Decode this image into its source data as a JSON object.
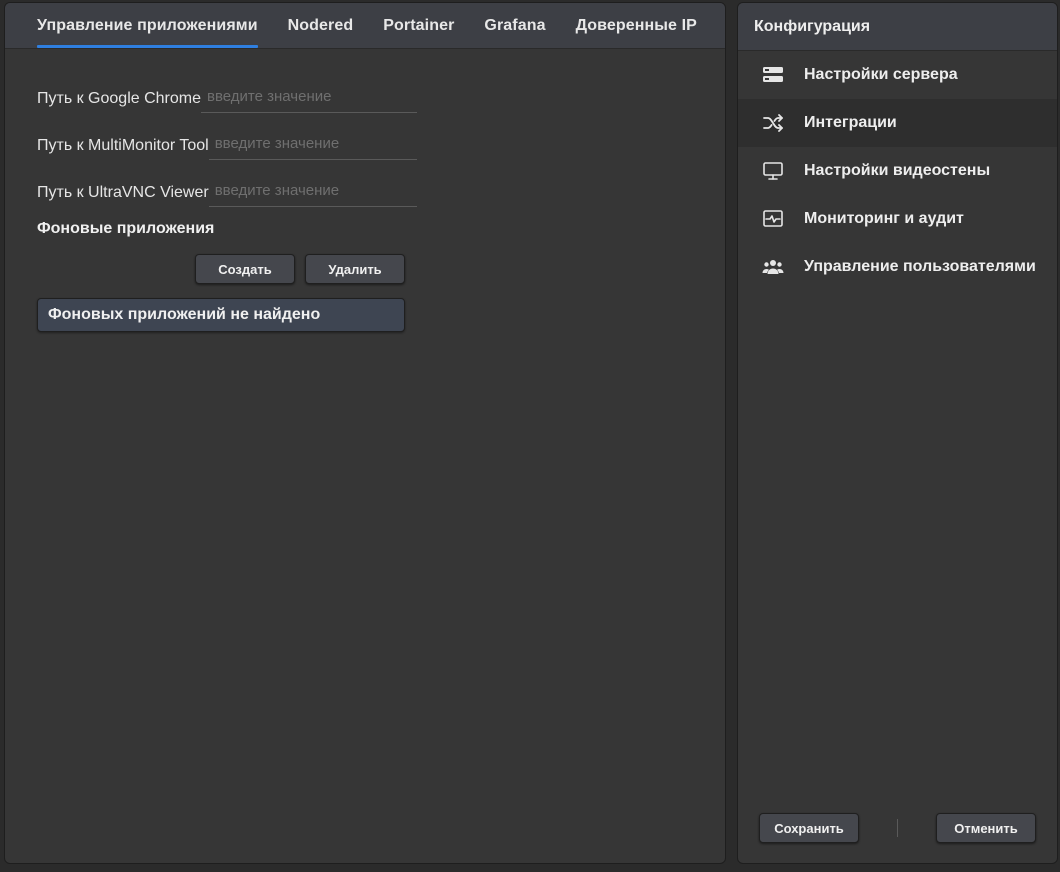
{
  "tabs": [
    {
      "label": "Управление приложениями",
      "active": true
    },
    {
      "label": "Nodered",
      "active": false
    },
    {
      "label": "Portainer",
      "active": false
    },
    {
      "label": "Grafana",
      "active": false
    },
    {
      "label": "Доверенные IP",
      "active": false
    }
  ],
  "form": {
    "fields": [
      {
        "label": "Путь к Google Chrome",
        "value": "",
        "placeholder": "введите значение"
      },
      {
        "label": "Путь к MultiMonitor Tool",
        "value": "",
        "placeholder": "введите значение"
      },
      {
        "label": "Путь к UltraVNC Viewer",
        "value": "",
        "placeholder": "введите значение"
      }
    ],
    "background_apps_title": "Фоновые приложения",
    "create_label": "Создать",
    "delete_label": "Удалить",
    "empty_message": "Фоновых приложений не найдено"
  },
  "sidebar": {
    "title": "Конфигурация",
    "items": [
      {
        "label": "Настройки сервера",
        "icon": "server-icon",
        "active": false
      },
      {
        "label": "Интеграции",
        "icon": "shuffle-icon",
        "active": true
      },
      {
        "label": "Настройки видеостены",
        "icon": "monitor-icon",
        "active": false
      },
      {
        "label": "Мониторинг и аудит",
        "icon": "activity-icon",
        "active": false
      },
      {
        "label": "Управление пользователями",
        "icon": "users-icon",
        "active": false
      }
    ],
    "save_label": "Сохранить",
    "cancel_label": "Отменить"
  },
  "colors": {
    "accent": "#2f7fe0",
    "panel": "#363636",
    "header": "#3d3f45",
    "empty_box": "#3e4552"
  }
}
